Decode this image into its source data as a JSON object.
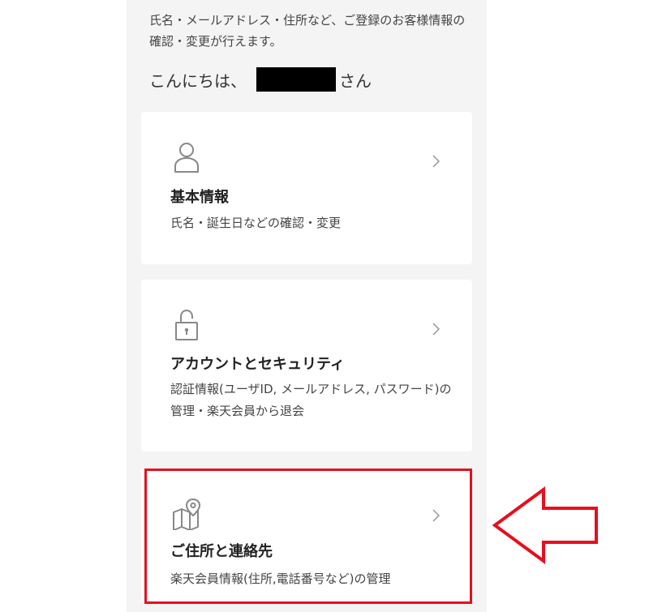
{
  "intro": {
    "text": "氏名・メールアドレス・住所など、ご登録のお客様情報の確認・変更が行えます。"
  },
  "greeting": {
    "prefix": "こんにちは、",
    "suffix": "さん"
  },
  "cards": [
    {
      "icon": "user-icon",
      "title": "基本情報",
      "description": "氏名・誕生日などの確認・変更"
    },
    {
      "icon": "lock-icon",
      "title": "アカウントとセキュリティ",
      "description": "認証情報(ユーザID, メールアドレス, パスワード)の管理・楽天会員から退会"
    },
    {
      "icon": "map-pin-icon",
      "title": "ご住所と連絡先",
      "description": "楽天会員情報(住所,電話番号など)の管理"
    }
  ],
  "colors": {
    "column_background": "#f4f4f4",
    "card_background": "#ffffff",
    "icon": "#888888",
    "annotation": "#e60f1e"
  }
}
